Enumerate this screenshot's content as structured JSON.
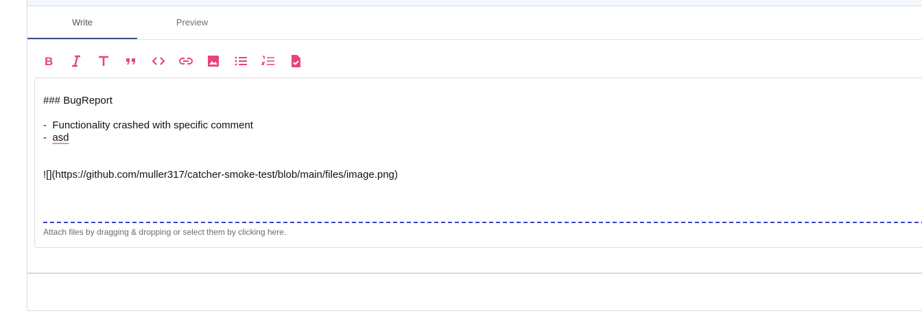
{
  "tabs": {
    "write": "Write",
    "preview": "Preview"
  },
  "toolbar": {
    "accent_color": "#e8437f",
    "icons": [
      "bold-icon",
      "italic-icon",
      "header-icon",
      "quote-icon",
      "code-icon",
      "link-icon",
      "image-icon",
      "bulleted-list-icon",
      "numbered-list-icon",
      "task-list-icon"
    ]
  },
  "editor": {
    "lines": [
      "### BugReport",
      "",
      "-  Functionality crashed with specific comment",
      "-  ",
      "",
      "",
      "![](https://github.com/muller317/catcher-smoke-test/blob/main/files/image.png)"
    ],
    "misspelled_word": "asd"
  },
  "attach_hint": "Attach files by dragging & dropping or select them by clicking here."
}
